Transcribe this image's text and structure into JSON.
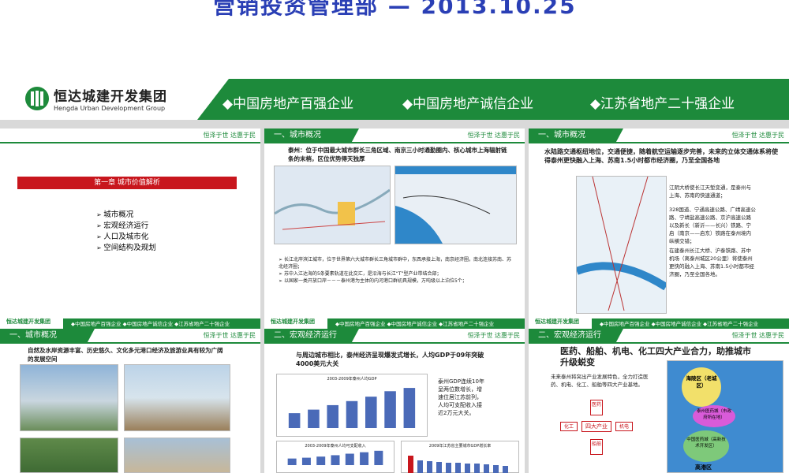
{
  "header": {
    "title": "营销投资管理部  —  2013.10.25"
  },
  "banner": {
    "logo_cn": "恒达城建开发集团",
    "logo_en": "Hengda Urban Development Group",
    "slogans": [
      "◆中国房地产百强企业",
      "◆中国房地产诚信企业",
      "◆江苏省地产二十强企业"
    ]
  },
  "common": {
    "motto": "恒泽于世 达惠于民",
    "footer_logo": "恒达城建开发集团",
    "footer_items": "◆中国房地产百强企业  ◆中国房地产诚信企业  ◆江苏省地产二十强企业"
  },
  "slides": [
    {
      "title": "",
      "chapter": "第一章 城市价值解析",
      "toc": [
        "城市概况",
        "宏观经济运行",
        "人口及城市化",
        "空间结构及规划"
      ]
    },
    {
      "title": "一、城市概况",
      "headline": "泰州：位于中国最大城市群长三角区域、南京三小时通勤圈内、核心城市上海辐射链条的末梢，区位优势得天独厚",
      "bullets": [
        "长江北岸滨江城市，位于世界第六大城市群长三角城市群中，东西承接上海，南京经济圈，南北连接苏南、苏北经济圈；",
        "苏中入江达海的5条要素轨道在此交汇，是沿海与长江“T”型产业带结合部；",
        "以国家一类开放口岸－－－泰州港为主体的内河港口群初具规模，万吨级以上泊位5个；"
      ]
    },
    {
      "title": "一、城市概况",
      "headline": "水陆路交通枢纽地位，交通便捷，随着航空运输逐步完善，未来的立体交通体系将使得泰州更快融入上海、苏南1.5小时都市经济圈，乃至全国各地",
      "body1": "江阴大桥使长江天堑变通，是泰州与上海、苏南的快速通道；",
      "body2": "328国道、宁通高速公路、广靖高速公路、宁靖盐高速公路、京沪高速公路以及新长（新沂——长兴）铁路、宁启（南京——启东）铁路在泰州境内纵横交错；",
      "body3": "在建泰州长江大桥、沪泰铁路、苏中机场（离泰州城区20公里）将使泰州更快的融入上海、苏南1.5小时都市经济圈，乃至全国各地。"
    },
    {
      "title": "一、城市概况",
      "headline": "自然及水岸资源丰富、历史悠久、文化多元港口经济及旅游业具有较为广阔的发展空间"
    },
    {
      "title": "二、宏观经济运行",
      "headline": "与周边城市相比，泰州经济呈现爆发式增长，人均GDP于09年突破4000美元大关",
      "side": "泰州GDP连续10年呈两位数增长，增速位居江苏前列，人均可支配收入接近2万元大关。",
      "chart1_title": "2003-2009年泰州人均GDP",
      "chart2_title": "2003-2009年泰州人均可支配收入",
      "chart3_title": "2009年江苏省主要城市GDP增长率"
    },
    {
      "title": "二、宏观经济运行",
      "headline": "医药、船舶、机电、化工四大产业合力，助推城市升级蜕变",
      "body": "未来泰州将突出产业发展特色，全力打造医药、机电、化工、船舶等四大产业基地。",
      "center": "四大产业",
      "n1": "医药",
      "n2": "化工",
      "n3": "机电",
      "n4": "船舶",
      "zone1": "海陵区（老城区）",
      "zone2": "泰州医药城（市政府所在地）",
      "zone3": "中国医药城（高新技术开发区）",
      "zone4": "高港区"
    }
  ],
  "chart_data": [
    {
      "type": "bar",
      "title": "2003-2009年泰州人均GDP",
      "categories": [
        "2003",
        "2004",
        "2005",
        "2006",
        "2007",
        "2008",
        "2009"
      ],
      "values": [
        11313,
        14014,
        17417,
        20491,
        23864,
        28000,
        30500
      ]
    },
    {
      "type": "bar",
      "title": "2003-2009年泰州人均可支配收入",
      "categories": [
        "2003",
        "2004",
        "2005",
        "2006",
        "2007",
        "2008",
        "2009"
      ],
      "values": [
        8600,
        9666,
        11122,
        12932,
        14900,
        16800,
        18700
      ]
    }
  ]
}
